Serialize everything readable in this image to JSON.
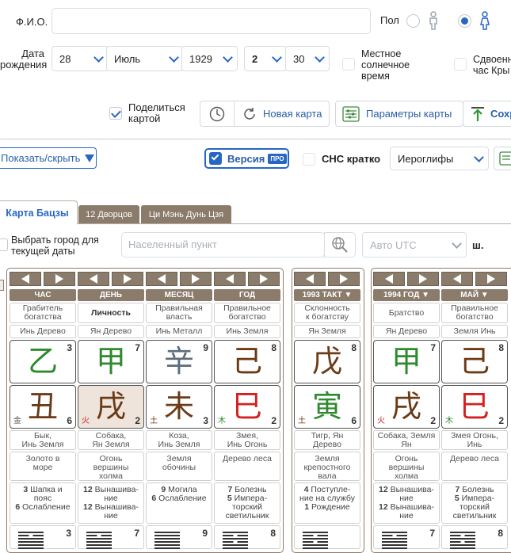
{
  "form": {
    "fio_label": "Ф.И.О.",
    "fio_value": "",
    "gender_label": "Пол",
    "date_label": "Дата\nрождения",
    "day": "28",
    "month": "Июль",
    "year": "1929",
    "hour": "2",
    "minute": "30",
    "local_solar_label": "Местное\nсолнечное\nвремя",
    "double_hour_label": "Сдвоенн\nчас Кры",
    "share_label": "Поделиться\nкартой"
  },
  "toolbar": {
    "new_chart": "Новая карта",
    "chart_params": "Параметры карты",
    "save": "Сохр"
  },
  "row2": {
    "show_hide": "Показать/скрыть",
    "version": "Версия",
    "pro_badge": "ПРО",
    "sns_short": "СНС кратко",
    "script_select": "Иероглифы"
  },
  "tabs": [
    "Карта Бацзы",
    "12 Дворцов",
    "Ци Мэнь Дунь Цзя"
  ],
  "city": {
    "label": "Выбрать город для\nтекущей даты",
    "placeholder": "Населенный пункт",
    "utc": "Авто UTC",
    "lat": "ш."
  },
  "columns": [
    {
      "head": "ЧАС",
      "god": "Грабитель\nбогатства",
      "hidden": "Инь Дерево",
      "stem": "乙",
      "stem_color": "#2e8a2e",
      "stem_num": "3",
      "branch": "丑",
      "branch_color": "#6b3a16",
      "branch_num": "6",
      "elem": "金",
      "elem_color": "#555",
      "animal": "Бык,\nИнь Земля",
      "nayin": "Золото в\nморе",
      "stars": [
        [
          "3",
          "Шапка и\nпояс"
        ],
        [
          "6",
          "Ослабление"
        ]
      ],
      "hex_num": "3",
      "hex": [
        1,
        0,
        1,
        1,
        1,
        1
      ]
    },
    {
      "head": "ДЕНЬ",
      "god": "Личность",
      "god_bold": true,
      "hidden": "Ян Дерево",
      "stem": "甲",
      "stem_color": "#2e8a2e",
      "stem_num": "7",
      "branch": "戌",
      "branch_color": "#6b3a16",
      "branch_num": "2",
      "elem": "火",
      "elem_color": "#d42020",
      "animal": "Собака,\nЯн Земля",
      "nayin": "Огонь\nвершины\nхолма",
      "stars": [
        [
          "12",
          "Вынашива-\nние"
        ],
        [
          "12",
          "Вынашива-\nние"
        ]
      ],
      "hex_num": "7",
      "hex": [
        1,
        0,
        1,
        1,
        1,
        1
      ],
      "highlight": true
    },
    {
      "head": "МЕСЯЦ",
      "god": "Правильная\nвласть",
      "hidden": "Инь Металл",
      "stem": "辛",
      "stem_color": "#5d6d7a",
      "stem_num": "9",
      "branch": "未",
      "branch_color": "#6b3a16",
      "branch_num": "3",
      "elem": "土",
      "elem_color": "#6b3a16",
      "animal": "Коза,\nИнь Земля",
      "nayin": "Земля\nобочины",
      "stars": [
        [
          "9",
          "Могила"
        ],
        [
          "6",
          "Ослабление"
        ]
      ],
      "hex_num": "9",
      "hex": [
        1,
        1,
        1,
        1,
        1,
        1
      ]
    },
    {
      "head": "ГОД",
      "god": "Правильное\nбогатство",
      "hidden": "Инь Земля",
      "stem": "己",
      "stem_color": "#6b3a16",
      "stem_num": "8",
      "branch": "巳",
      "branch_color": "#d42020",
      "branch_num": "2",
      "elem": "木",
      "elem_color": "#2e8a2e",
      "animal": "Змея,\nИнь Огонь",
      "nayin": "Дерево леса",
      "stars": [
        [
          "7",
          "Болезнь"
        ],
        [
          "5",
          "Импера-\nторский\nсветильник"
        ]
      ],
      "hex_num": "8",
      "hex": [
        1,
        0,
        1,
        0,
        1,
        1
      ]
    },
    {
      "head": "1993 ТАКТ ▼",
      "god": "Склонность\nк богатству",
      "hidden": "Ян Земля",
      "stem": "戊",
      "stem_color": "#6b3a16",
      "stem_num": "8",
      "branch": "寅",
      "branch_color": "#2e8a2e",
      "branch_num": "6",
      "elem": "土",
      "elem_color": "#6b3a16",
      "animal": "Тигр, Ян\nДерево",
      "nayin": "Земля\nкрепостного\nвала",
      "stars": [
        [
          "4",
          "Поступле-\nние на службу"
        ],
        [
          "1",
          "Рождение"
        ]
      ],
      "hex_num": "",
      "hex": [
        1,
        0,
        1,
        0,
        1,
        1
      ]
    },
    {
      "head": "1994 ГОД ▼",
      "god": "Братство",
      "hidden": "Ян Дерево",
      "stem": "甲",
      "stem_color": "#2e8a2e",
      "stem_num": "7",
      "branch": "戌",
      "branch_color": "#6b3a16",
      "branch_num": "2",
      "elem": "火",
      "elem_color": "#d42020",
      "animal": "Собака, Земля\nЯн",
      "nayin": "Огонь\nвершины\nхолма",
      "stars": [
        [
          "12",
          "Вынашива-\nние"
        ],
        [
          "12",
          "Вынашива-\nние"
        ]
      ],
      "hex_num": "7",
      "hex": [
        1,
        0,
        1,
        1,
        1,
        1
      ]
    },
    {
      "head": "МАЙ ▼",
      "god": "Правильное\nбогатство",
      "hidden": "Земля Инь",
      "stem": "己",
      "stem_color": "#6b3a16",
      "stem_num": "8",
      "branch": "巳",
      "branch_color": "#d42020",
      "branch_num": "2",
      "elem": "木",
      "elem_color": "#2e8a2e",
      "animal": "Змея Огонь,\nИнь",
      "nayin": "Дерево леса",
      "stars": [
        [
          "7",
          "Болезнь"
        ],
        [
          "5",
          "Импера-\nторский\nсветильник"
        ]
      ],
      "hex_num": "8",
      "hex": [
        1,
        0,
        1,
        0,
        1,
        1
      ]
    }
  ]
}
